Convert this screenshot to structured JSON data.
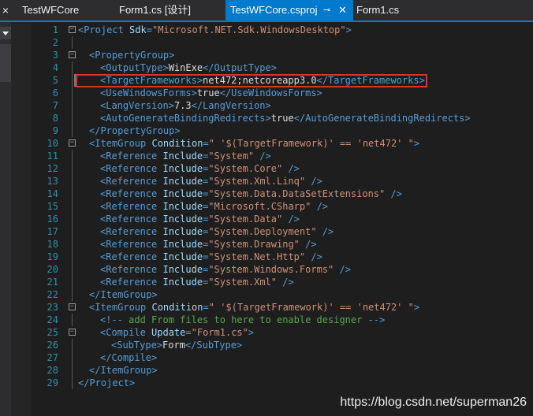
{
  "tabs": [
    {
      "label": "TestWFCore",
      "active": false
    },
    {
      "label": "Form1.cs [设计]",
      "active": false
    },
    {
      "label": "TestWFCore.csproj",
      "active": true,
      "pin_icon": "pin-icon",
      "close_icon": "close-icon"
    },
    {
      "label": "Form1.cs",
      "active": false
    }
  ],
  "left_strip": {
    "close_glyph": "×",
    "dropdown_icon": "chevron-down-icon"
  },
  "editor": {
    "highlighted_line": 5,
    "lines": [
      {
        "n": "1",
        "fold": "-",
        "indent": 0,
        "tokens": [
          {
            "c": "t-tag",
            "t": "<"
          },
          {
            "c": "t-tag",
            "t": "Project"
          },
          {
            "c": "t-text",
            "t": " "
          },
          {
            "c": "t-attr",
            "t": "Sdk"
          },
          {
            "c": "t-tag",
            "t": "="
          },
          {
            "c": "t-val",
            "t": "\"Microsoft.NET.Sdk.WindowsDesktop\""
          },
          {
            "c": "t-tag",
            "t": ">"
          }
        ]
      },
      {
        "n": "2",
        "fold": "",
        "indent": 0,
        "tokens": []
      },
      {
        "n": "3",
        "fold": "-",
        "indent": 1,
        "tokens": [
          {
            "c": "t-tag",
            "t": "<PropertyGroup>"
          }
        ]
      },
      {
        "n": "4",
        "fold": "",
        "indent": 2,
        "tokens": [
          {
            "c": "t-tag",
            "t": "<OutputType>"
          },
          {
            "c": "t-text",
            "t": "WinExe"
          },
          {
            "c": "t-tag",
            "t": "</OutputType>"
          }
        ]
      },
      {
        "n": "5",
        "fold": "",
        "indent": 2,
        "tokens": [
          {
            "c": "t-tag",
            "t": "<TargetFrameworks>"
          },
          {
            "c": "t-text",
            "t": "net472;netcoreapp3.0"
          },
          {
            "c": "t-tag",
            "t": "</TargetFrameworks>"
          }
        ]
      },
      {
        "n": "6",
        "fold": "",
        "indent": 2,
        "tokens": [
          {
            "c": "t-tag",
            "t": "<UseWindowsForms>"
          },
          {
            "c": "t-text",
            "t": "true"
          },
          {
            "c": "t-tag",
            "t": "</UseWindowsForms>"
          }
        ]
      },
      {
        "n": "7",
        "fold": "",
        "indent": 2,
        "tokens": [
          {
            "c": "t-tag",
            "t": "<LangVersion>"
          },
          {
            "c": "t-text",
            "t": "7.3"
          },
          {
            "c": "t-tag",
            "t": "</LangVersion>"
          }
        ]
      },
      {
        "n": "8",
        "fold": "",
        "indent": 2,
        "tokens": [
          {
            "c": "t-tag",
            "t": "<AutoGenerateBindingRedirects>"
          },
          {
            "c": "t-text",
            "t": "true"
          },
          {
            "c": "t-tag",
            "t": "</AutoGenerateBindingRedirects>"
          }
        ]
      },
      {
        "n": "9",
        "fold": "",
        "indent": 1,
        "tokens": [
          {
            "c": "t-tag",
            "t": "</PropertyGroup>"
          }
        ]
      },
      {
        "n": "10",
        "fold": "-",
        "indent": 1,
        "tokens": [
          {
            "c": "t-tag",
            "t": "<ItemGroup "
          },
          {
            "c": "t-attr",
            "t": "Condition"
          },
          {
            "c": "t-tag",
            "t": "="
          },
          {
            "c": "t-val",
            "t": "\" '$(TargetFramework)' == 'net472' \""
          },
          {
            "c": "t-tag",
            "t": ">"
          }
        ]
      },
      {
        "n": "11",
        "fold": "",
        "indent": 2,
        "tokens": [
          {
            "c": "t-tag",
            "t": "<Reference "
          },
          {
            "c": "t-attr",
            "t": "Include"
          },
          {
            "c": "t-tag",
            "t": "="
          },
          {
            "c": "t-val",
            "t": "\"System\""
          },
          {
            "c": "t-tag",
            "t": " />"
          }
        ]
      },
      {
        "n": "12",
        "fold": "",
        "indent": 2,
        "tokens": [
          {
            "c": "t-tag",
            "t": "<Reference "
          },
          {
            "c": "t-attr",
            "t": "Include"
          },
          {
            "c": "t-tag",
            "t": "="
          },
          {
            "c": "t-val",
            "t": "\"System.Core\""
          },
          {
            "c": "t-tag",
            "t": " />"
          }
        ]
      },
      {
        "n": "13",
        "fold": "",
        "indent": 2,
        "tokens": [
          {
            "c": "t-tag",
            "t": "<Reference "
          },
          {
            "c": "t-attr",
            "t": "Include"
          },
          {
            "c": "t-tag",
            "t": "="
          },
          {
            "c": "t-val",
            "t": "\"System.Xml.Linq\""
          },
          {
            "c": "t-tag",
            "t": " />"
          }
        ]
      },
      {
        "n": "14",
        "fold": "",
        "indent": 2,
        "tokens": [
          {
            "c": "t-tag",
            "t": "<Reference "
          },
          {
            "c": "t-attr",
            "t": "Include"
          },
          {
            "c": "t-tag",
            "t": "="
          },
          {
            "c": "t-val",
            "t": "\"System.Data.DataSetExtensions\""
          },
          {
            "c": "t-tag",
            "t": " />"
          }
        ]
      },
      {
        "n": "15",
        "fold": "",
        "indent": 2,
        "tokens": [
          {
            "c": "t-tag",
            "t": "<Reference "
          },
          {
            "c": "t-attr",
            "t": "Include"
          },
          {
            "c": "t-tag",
            "t": "="
          },
          {
            "c": "t-val",
            "t": "\"Microsoft.CSharp\""
          },
          {
            "c": "t-tag",
            "t": " />"
          }
        ]
      },
      {
        "n": "16",
        "fold": "",
        "indent": 2,
        "tokens": [
          {
            "c": "t-tag",
            "t": "<Reference "
          },
          {
            "c": "t-attr",
            "t": "Include"
          },
          {
            "c": "t-tag",
            "t": "="
          },
          {
            "c": "t-val",
            "t": "\"System.Data\""
          },
          {
            "c": "t-tag",
            "t": " />"
          }
        ]
      },
      {
        "n": "17",
        "fold": "",
        "indent": 2,
        "tokens": [
          {
            "c": "t-tag",
            "t": "<Reference "
          },
          {
            "c": "t-attr",
            "t": "Include"
          },
          {
            "c": "t-tag",
            "t": "="
          },
          {
            "c": "t-val",
            "t": "\"System.Deployment\""
          },
          {
            "c": "t-tag",
            "t": " />"
          }
        ]
      },
      {
        "n": "18",
        "fold": "",
        "indent": 2,
        "tokens": [
          {
            "c": "t-tag",
            "t": "<Reference "
          },
          {
            "c": "t-attr",
            "t": "Include"
          },
          {
            "c": "t-tag",
            "t": "="
          },
          {
            "c": "t-val",
            "t": "\"System.Drawing\""
          },
          {
            "c": "t-tag",
            "t": " />"
          }
        ]
      },
      {
        "n": "19",
        "fold": "",
        "indent": 2,
        "tokens": [
          {
            "c": "t-tag",
            "t": "<Reference "
          },
          {
            "c": "t-attr",
            "t": "Include"
          },
          {
            "c": "t-tag",
            "t": "="
          },
          {
            "c": "t-val",
            "t": "\"System.Net.Http\""
          },
          {
            "c": "t-tag",
            "t": " />"
          }
        ]
      },
      {
        "n": "20",
        "fold": "",
        "indent": 2,
        "tokens": [
          {
            "c": "t-tag",
            "t": "<Reference "
          },
          {
            "c": "t-attr",
            "t": "Include"
          },
          {
            "c": "t-tag",
            "t": "="
          },
          {
            "c": "t-val",
            "t": "\"System.Windows.Forms\""
          },
          {
            "c": "t-tag",
            "t": " />"
          }
        ]
      },
      {
        "n": "21",
        "fold": "",
        "indent": 2,
        "tokens": [
          {
            "c": "t-tag",
            "t": "<Reference "
          },
          {
            "c": "t-attr",
            "t": "Include"
          },
          {
            "c": "t-tag",
            "t": "="
          },
          {
            "c": "t-val",
            "t": "\"System.Xml\""
          },
          {
            "c": "t-tag",
            "t": " />"
          }
        ]
      },
      {
        "n": "22",
        "fold": "",
        "indent": 1,
        "tokens": [
          {
            "c": "t-tag",
            "t": "</ItemGroup>"
          }
        ]
      },
      {
        "n": "23",
        "fold": "-",
        "indent": 1,
        "tokens": [
          {
            "c": "t-tag",
            "t": "<ItemGroup "
          },
          {
            "c": "t-attr",
            "t": "Condition"
          },
          {
            "c": "t-tag",
            "t": "="
          },
          {
            "c": "t-val",
            "t": "\" '$(TargetFramework)' == 'net472' \""
          },
          {
            "c": "t-tag",
            "t": ">"
          }
        ]
      },
      {
        "n": "24",
        "fold": "",
        "indent": 2,
        "tokens": [
          {
            "c": "t-tag",
            "t": "<!--"
          },
          {
            "c": "t-cmt",
            "t": " add From files to here to enable designer "
          },
          {
            "c": "t-tag",
            "t": "-->"
          }
        ]
      },
      {
        "n": "25",
        "fold": "-",
        "indent": 2,
        "tokens": [
          {
            "c": "t-tag",
            "t": "<Compile "
          },
          {
            "c": "t-attr",
            "t": "Update"
          },
          {
            "c": "t-tag",
            "t": "="
          },
          {
            "c": "t-val",
            "t": "\"Form1.cs\""
          },
          {
            "c": "t-tag",
            "t": ">"
          }
        ]
      },
      {
        "n": "26",
        "fold": "",
        "indent": 3,
        "tokens": [
          {
            "c": "t-tag",
            "t": "<SubType>"
          },
          {
            "c": "t-text",
            "t": "Form"
          },
          {
            "c": "t-tag",
            "t": "</SubType>"
          }
        ]
      },
      {
        "n": "27",
        "fold": "",
        "indent": 2,
        "tokens": [
          {
            "c": "t-tag",
            "t": "</Compile>"
          }
        ]
      },
      {
        "n": "28",
        "fold": "",
        "indent": 1,
        "tokens": [
          {
            "c": "t-tag",
            "t": "</ItemGroup>"
          }
        ]
      },
      {
        "n": "29",
        "fold": "",
        "indent": 0,
        "tokens": [
          {
            "c": "t-tag",
            "t": "</Project>"
          }
        ]
      }
    ]
  },
  "watermark": "https://blog.csdn.net/superman26",
  "colors": {
    "accent": "#007acc",
    "highlight_box": "#e0312d",
    "tag": "#569cd6",
    "attribute": "#9cdcfe",
    "value": "#ce9178",
    "comment": "#57a64a",
    "line_number": "#2b91af"
  }
}
